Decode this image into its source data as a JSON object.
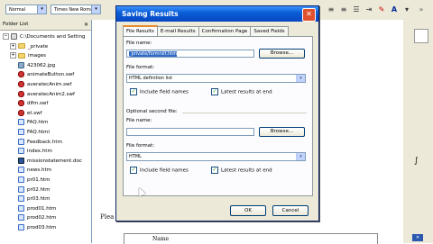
{
  "toolbar": {
    "style_select": "Normal",
    "font_select": "Times New Roman"
  },
  "folder_list": {
    "title": "Folder List",
    "items": [
      {
        "label": "C:\\Documents and Setting",
        "icon": "root"
      },
      {
        "label": "_private",
        "icon": "folder"
      },
      {
        "label": "images",
        "icon": "folder"
      },
      {
        "label": "423062.jpg",
        "icon": "img"
      },
      {
        "label": "animateButton.swf",
        "icon": "swf"
      },
      {
        "label": "averatecAnim.swf",
        "icon": "swf"
      },
      {
        "label": "averatecAnim2.swf",
        "icon": "swf"
      },
      {
        "label": "dlfm.swf",
        "icon": "swf"
      },
      {
        "label": "et.swf",
        "icon": "swf"
      },
      {
        "label": "FAQ.htm",
        "icon": "htm"
      },
      {
        "label": "FAQ.html",
        "icon": "htm"
      },
      {
        "label": "Feedback.htm",
        "icon": "htm"
      },
      {
        "label": "index.htm",
        "icon": "htm"
      },
      {
        "label": "missionstatement.doc",
        "icon": "doc"
      },
      {
        "label": "news.htm",
        "icon": "htm"
      },
      {
        "label": "pr01.htm",
        "icon": "htm"
      },
      {
        "label": "pr02.htm",
        "icon": "htm"
      },
      {
        "label": "pr03.htm",
        "icon": "htm"
      },
      {
        "label": "prod01.htm",
        "icon": "htm"
      },
      {
        "label": "prod02.htm",
        "icon": "htm"
      },
      {
        "label": "prod03.htm",
        "icon": "htm"
      }
    ]
  },
  "document": {
    "fragment_left": "Plea",
    "fragment_bottom": "Name"
  },
  "dialog": {
    "title": "Saving Results",
    "tabs": [
      "File Results",
      "E-mail Results",
      "Confirmation Page",
      "Saved Fields"
    ],
    "file_name_label": "File name:",
    "file_name_value": "_private/formrslt.htm",
    "browse_label": "Browse...",
    "file_format_label": "File format:",
    "file_format_value": "HTML definition list",
    "include_field_names_label": "Include field names",
    "latest_results_label": "Latest results at end",
    "optional_label": "Optional second file:",
    "file_name2_label": "File name:",
    "file_name2_value": "",
    "browse2_label": "Browse...",
    "file_format2_label": "File format:",
    "file_format2_value": "HTML",
    "include_field_names2_label": "Include field names",
    "latest_results2_label": "Latest results at end",
    "ok_label": "OK",
    "cancel_label": "Cancel"
  }
}
